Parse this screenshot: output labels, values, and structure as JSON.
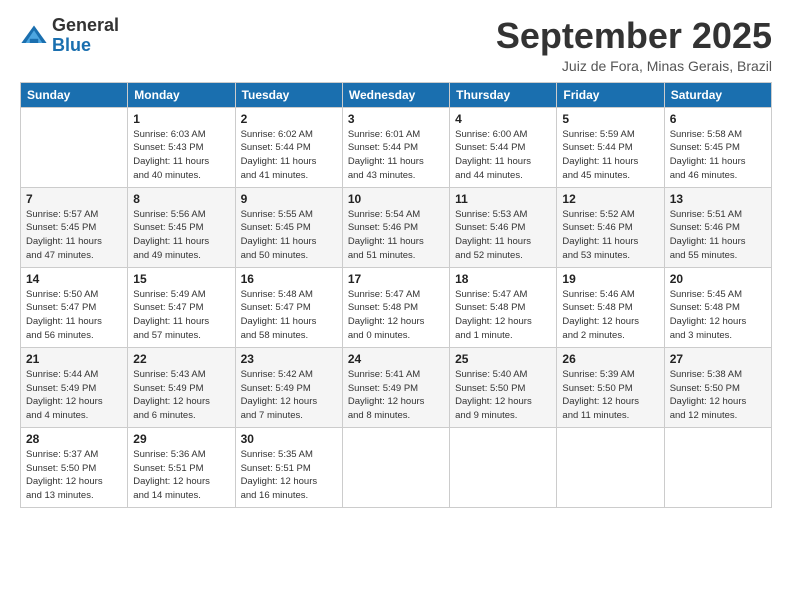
{
  "logo": {
    "general": "General",
    "blue": "Blue"
  },
  "title": "September 2025",
  "subtitle": "Juiz de Fora, Minas Gerais, Brazil",
  "days_of_week": [
    "Sunday",
    "Monday",
    "Tuesday",
    "Wednesday",
    "Thursday",
    "Friday",
    "Saturday"
  ],
  "weeks": [
    [
      {
        "day": "",
        "info": ""
      },
      {
        "day": "1",
        "info": "Sunrise: 6:03 AM\nSunset: 5:43 PM\nDaylight: 11 hours\nand 40 minutes."
      },
      {
        "day": "2",
        "info": "Sunrise: 6:02 AM\nSunset: 5:44 PM\nDaylight: 11 hours\nand 41 minutes."
      },
      {
        "day": "3",
        "info": "Sunrise: 6:01 AM\nSunset: 5:44 PM\nDaylight: 11 hours\nand 43 minutes."
      },
      {
        "day": "4",
        "info": "Sunrise: 6:00 AM\nSunset: 5:44 PM\nDaylight: 11 hours\nand 44 minutes."
      },
      {
        "day": "5",
        "info": "Sunrise: 5:59 AM\nSunset: 5:44 PM\nDaylight: 11 hours\nand 45 minutes."
      },
      {
        "day": "6",
        "info": "Sunrise: 5:58 AM\nSunset: 5:45 PM\nDaylight: 11 hours\nand 46 minutes."
      }
    ],
    [
      {
        "day": "7",
        "info": "Sunrise: 5:57 AM\nSunset: 5:45 PM\nDaylight: 11 hours\nand 47 minutes."
      },
      {
        "day": "8",
        "info": "Sunrise: 5:56 AM\nSunset: 5:45 PM\nDaylight: 11 hours\nand 49 minutes."
      },
      {
        "day": "9",
        "info": "Sunrise: 5:55 AM\nSunset: 5:45 PM\nDaylight: 11 hours\nand 50 minutes."
      },
      {
        "day": "10",
        "info": "Sunrise: 5:54 AM\nSunset: 5:46 PM\nDaylight: 11 hours\nand 51 minutes."
      },
      {
        "day": "11",
        "info": "Sunrise: 5:53 AM\nSunset: 5:46 PM\nDaylight: 11 hours\nand 52 minutes."
      },
      {
        "day": "12",
        "info": "Sunrise: 5:52 AM\nSunset: 5:46 PM\nDaylight: 11 hours\nand 53 minutes."
      },
      {
        "day": "13",
        "info": "Sunrise: 5:51 AM\nSunset: 5:46 PM\nDaylight: 11 hours\nand 55 minutes."
      }
    ],
    [
      {
        "day": "14",
        "info": "Sunrise: 5:50 AM\nSunset: 5:47 PM\nDaylight: 11 hours\nand 56 minutes."
      },
      {
        "day": "15",
        "info": "Sunrise: 5:49 AM\nSunset: 5:47 PM\nDaylight: 11 hours\nand 57 minutes."
      },
      {
        "day": "16",
        "info": "Sunrise: 5:48 AM\nSunset: 5:47 PM\nDaylight: 11 hours\nand 58 minutes."
      },
      {
        "day": "17",
        "info": "Sunrise: 5:47 AM\nSunset: 5:48 PM\nDaylight: 12 hours\nand 0 minutes."
      },
      {
        "day": "18",
        "info": "Sunrise: 5:47 AM\nSunset: 5:48 PM\nDaylight: 12 hours\nand 1 minute."
      },
      {
        "day": "19",
        "info": "Sunrise: 5:46 AM\nSunset: 5:48 PM\nDaylight: 12 hours\nand 2 minutes."
      },
      {
        "day": "20",
        "info": "Sunrise: 5:45 AM\nSunset: 5:48 PM\nDaylight: 12 hours\nand 3 minutes."
      }
    ],
    [
      {
        "day": "21",
        "info": "Sunrise: 5:44 AM\nSunset: 5:49 PM\nDaylight: 12 hours\nand 4 minutes."
      },
      {
        "day": "22",
        "info": "Sunrise: 5:43 AM\nSunset: 5:49 PM\nDaylight: 12 hours\nand 6 minutes."
      },
      {
        "day": "23",
        "info": "Sunrise: 5:42 AM\nSunset: 5:49 PM\nDaylight: 12 hours\nand 7 minutes."
      },
      {
        "day": "24",
        "info": "Sunrise: 5:41 AM\nSunset: 5:49 PM\nDaylight: 12 hours\nand 8 minutes."
      },
      {
        "day": "25",
        "info": "Sunrise: 5:40 AM\nSunset: 5:50 PM\nDaylight: 12 hours\nand 9 minutes."
      },
      {
        "day": "26",
        "info": "Sunrise: 5:39 AM\nSunset: 5:50 PM\nDaylight: 12 hours\nand 11 minutes."
      },
      {
        "day": "27",
        "info": "Sunrise: 5:38 AM\nSunset: 5:50 PM\nDaylight: 12 hours\nand 12 minutes."
      }
    ],
    [
      {
        "day": "28",
        "info": "Sunrise: 5:37 AM\nSunset: 5:50 PM\nDaylight: 12 hours\nand 13 minutes."
      },
      {
        "day": "29",
        "info": "Sunrise: 5:36 AM\nSunset: 5:51 PM\nDaylight: 12 hours\nand 14 minutes."
      },
      {
        "day": "30",
        "info": "Sunrise: 5:35 AM\nSunset: 5:51 PM\nDaylight: 12 hours\nand 16 minutes."
      },
      {
        "day": "",
        "info": ""
      },
      {
        "day": "",
        "info": ""
      },
      {
        "day": "",
        "info": ""
      },
      {
        "day": "",
        "info": ""
      }
    ]
  ]
}
